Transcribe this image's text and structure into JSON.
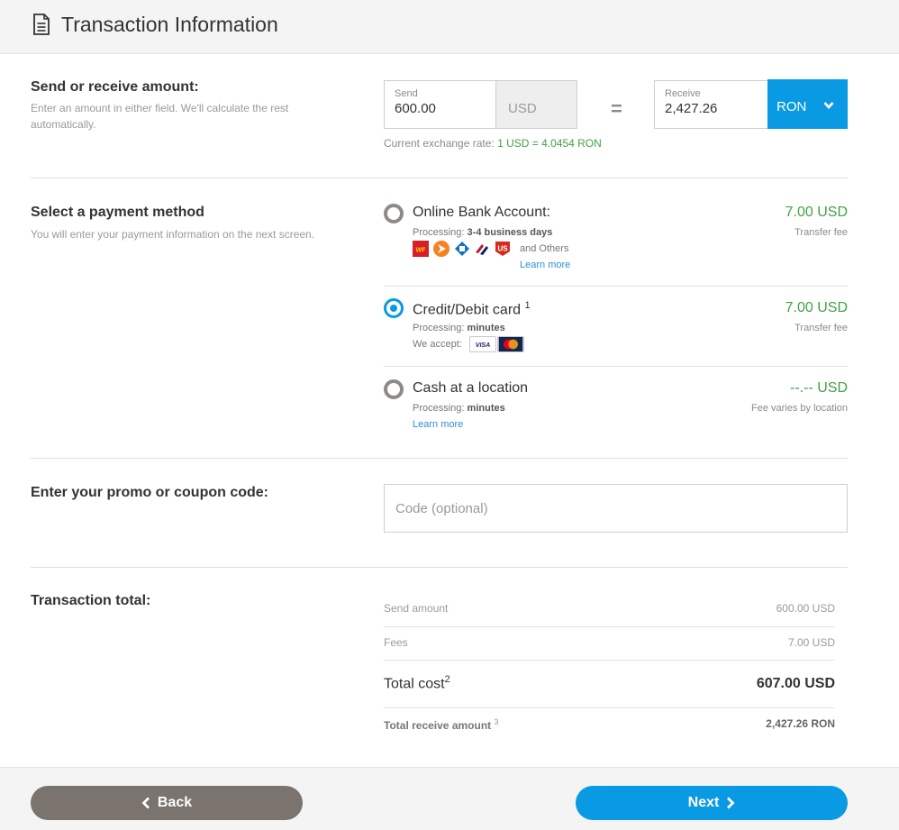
{
  "header": {
    "title": "Transaction Information",
    "icon": "document-icon"
  },
  "amount_section": {
    "label": "Send or receive amount:",
    "help": "Enter an amount in either field. We'll calculate the rest automatically.",
    "send_label": "Send",
    "send_value": "600.00",
    "send_currency": "USD",
    "equals": "=",
    "receive_label": "Receive",
    "receive_value": "2,427.26",
    "receive_currency": "RON",
    "rate_prefix": "Current exchange rate: ",
    "rate_value": "1 USD = 4.0454 RON"
  },
  "payment_section": {
    "label": "Select a payment method",
    "help": "You will enter your payment information on the next screen.",
    "options": [
      {
        "title": "Online Bank Account:",
        "processing_label": "Processing:",
        "processing_value": "3-4 business days",
        "others": "and Others",
        "learn_more": "Learn more",
        "fee": "7.00 USD",
        "fee_note": "Transfer fee",
        "selected": false
      },
      {
        "title": "Credit/Debit card",
        "sup": "1",
        "processing_label": "Processing:",
        "processing_value": "minutes",
        "accept_label": "We accept:",
        "visa": "VISA",
        "fee": "7.00 USD",
        "fee_note": "Transfer fee",
        "selected": true
      },
      {
        "title": "Cash at a location",
        "processing_label": "Processing:",
        "processing_value": "minutes",
        "learn_more": "Learn more",
        "fee": "--.-- USD",
        "fee_note": "Fee varies by location",
        "selected": false
      }
    ],
    "bank_logos": [
      "WF",
      "US"
    ]
  },
  "promo_section": {
    "label": "Enter your promo or coupon code:",
    "placeholder": "Code (optional)",
    "value": ""
  },
  "total_section": {
    "label": "Transaction total:",
    "send_amount_label": "Send amount",
    "send_amount_value": "600.00 USD",
    "fees_label": "Fees",
    "fees_value": "7.00 USD",
    "total_cost_label": "Total cost",
    "total_cost_sup": "2",
    "total_cost_value": "607.00 USD",
    "receive_label": "Total receive amount",
    "receive_sup": "3",
    "receive_value": "2,427.26 RON"
  },
  "footer": {
    "back_label": "Back",
    "next_label": "Next"
  },
  "colors": {
    "accent": "#0a9ae3",
    "fee_green": "#43a047",
    "back_gray": "#7a736e"
  }
}
